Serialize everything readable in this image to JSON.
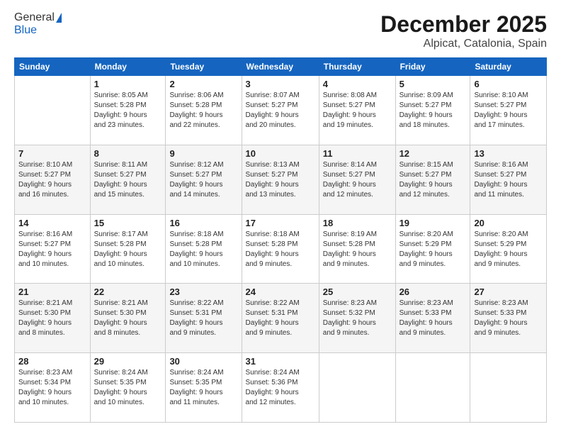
{
  "logo": {
    "line1": "General",
    "line2": "Blue"
  },
  "title": "December 2025",
  "location": "Alpicat, Catalonia, Spain",
  "days_of_week": [
    "Sunday",
    "Monday",
    "Tuesday",
    "Wednesday",
    "Thursday",
    "Friday",
    "Saturday"
  ],
  "weeks": [
    [
      {
        "day": "",
        "content": ""
      },
      {
        "day": "1",
        "content": "Sunrise: 8:05 AM\nSunset: 5:28 PM\nDaylight: 9 hours\nand 23 minutes."
      },
      {
        "day": "2",
        "content": "Sunrise: 8:06 AM\nSunset: 5:28 PM\nDaylight: 9 hours\nand 22 minutes."
      },
      {
        "day": "3",
        "content": "Sunrise: 8:07 AM\nSunset: 5:27 PM\nDaylight: 9 hours\nand 20 minutes."
      },
      {
        "day": "4",
        "content": "Sunrise: 8:08 AM\nSunset: 5:27 PM\nDaylight: 9 hours\nand 19 minutes."
      },
      {
        "day": "5",
        "content": "Sunrise: 8:09 AM\nSunset: 5:27 PM\nDaylight: 9 hours\nand 18 minutes."
      },
      {
        "day": "6",
        "content": "Sunrise: 8:10 AM\nSunset: 5:27 PM\nDaylight: 9 hours\nand 17 minutes."
      }
    ],
    [
      {
        "day": "7",
        "content": "Sunrise: 8:10 AM\nSunset: 5:27 PM\nDaylight: 9 hours\nand 16 minutes."
      },
      {
        "day": "8",
        "content": "Sunrise: 8:11 AM\nSunset: 5:27 PM\nDaylight: 9 hours\nand 15 minutes."
      },
      {
        "day": "9",
        "content": "Sunrise: 8:12 AM\nSunset: 5:27 PM\nDaylight: 9 hours\nand 14 minutes."
      },
      {
        "day": "10",
        "content": "Sunrise: 8:13 AM\nSunset: 5:27 PM\nDaylight: 9 hours\nand 13 minutes."
      },
      {
        "day": "11",
        "content": "Sunrise: 8:14 AM\nSunset: 5:27 PM\nDaylight: 9 hours\nand 12 minutes."
      },
      {
        "day": "12",
        "content": "Sunrise: 8:15 AM\nSunset: 5:27 PM\nDaylight: 9 hours\nand 12 minutes."
      },
      {
        "day": "13",
        "content": "Sunrise: 8:16 AM\nSunset: 5:27 PM\nDaylight: 9 hours\nand 11 minutes."
      }
    ],
    [
      {
        "day": "14",
        "content": "Sunrise: 8:16 AM\nSunset: 5:27 PM\nDaylight: 9 hours\nand 10 minutes."
      },
      {
        "day": "15",
        "content": "Sunrise: 8:17 AM\nSunset: 5:28 PM\nDaylight: 9 hours\nand 10 minutes."
      },
      {
        "day": "16",
        "content": "Sunrise: 8:18 AM\nSunset: 5:28 PM\nDaylight: 9 hours\nand 10 minutes."
      },
      {
        "day": "17",
        "content": "Sunrise: 8:18 AM\nSunset: 5:28 PM\nDaylight: 9 hours\nand 9 minutes."
      },
      {
        "day": "18",
        "content": "Sunrise: 8:19 AM\nSunset: 5:28 PM\nDaylight: 9 hours\nand 9 minutes."
      },
      {
        "day": "19",
        "content": "Sunrise: 8:20 AM\nSunset: 5:29 PM\nDaylight: 9 hours\nand 9 minutes."
      },
      {
        "day": "20",
        "content": "Sunrise: 8:20 AM\nSunset: 5:29 PM\nDaylight: 9 hours\nand 9 minutes."
      }
    ],
    [
      {
        "day": "21",
        "content": "Sunrise: 8:21 AM\nSunset: 5:30 PM\nDaylight: 9 hours\nand 8 minutes."
      },
      {
        "day": "22",
        "content": "Sunrise: 8:21 AM\nSunset: 5:30 PM\nDaylight: 9 hours\nand 8 minutes."
      },
      {
        "day": "23",
        "content": "Sunrise: 8:22 AM\nSunset: 5:31 PM\nDaylight: 9 hours\nand 9 minutes."
      },
      {
        "day": "24",
        "content": "Sunrise: 8:22 AM\nSunset: 5:31 PM\nDaylight: 9 hours\nand 9 minutes."
      },
      {
        "day": "25",
        "content": "Sunrise: 8:23 AM\nSunset: 5:32 PM\nDaylight: 9 hours\nand 9 minutes."
      },
      {
        "day": "26",
        "content": "Sunrise: 8:23 AM\nSunset: 5:33 PM\nDaylight: 9 hours\nand 9 minutes."
      },
      {
        "day": "27",
        "content": "Sunrise: 8:23 AM\nSunset: 5:33 PM\nDaylight: 9 hours\nand 9 minutes."
      }
    ],
    [
      {
        "day": "28",
        "content": "Sunrise: 8:23 AM\nSunset: 5:34 PM\nDaylight: 9 hours\nand 10 minutes."
      },
      {
        "day": "29",
        "content": "Sunrise: 8:24 AM\nSunset: 5:35 PM\nDaylight: 9 hours\nand 10 minutes."
      },
      {
        "day": "30",
        "content": "Sunrise: 8:24 AM\nSunset: 5:35 PM\nDaylight: 9 hours\nand 11 minutes."
      },
      {
        "day": "31",
        "content": "Sunrise: 8:24 AM\nSunset: 5:36 PM\nDaylight: 9 hours\nand 12 minutes."
      },
      {
        "day": "",
        "content": ""
      },
      {
        "day": "",
        "content": ""
      },
      {
        "day": "",
        "content": ""
      }
    ]
  ]
}
